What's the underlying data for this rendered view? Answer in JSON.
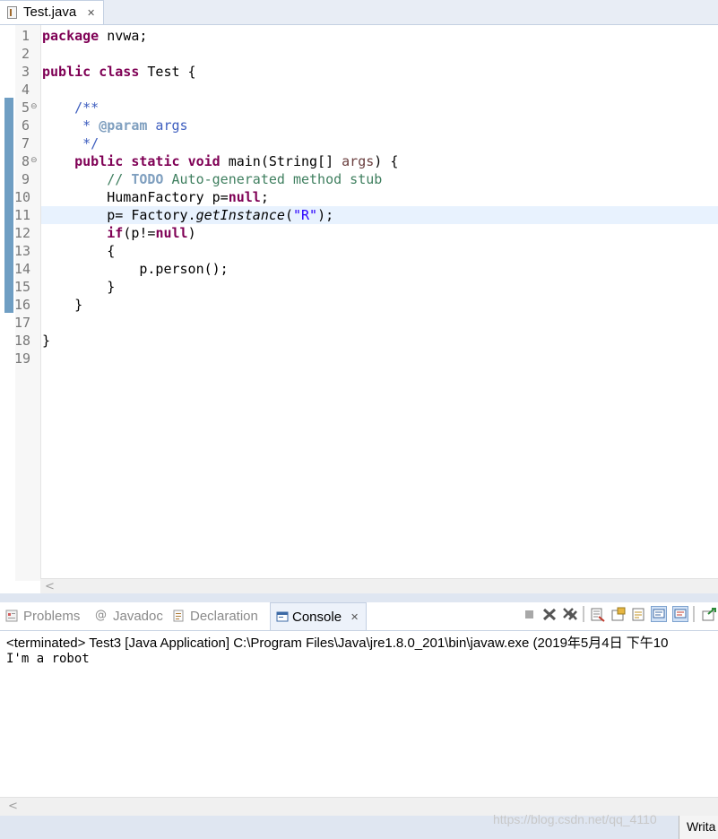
{
  "editor": {
    "tab": {
      "label": "Test.java",
      "close": "✕"
    },
    "lines": [
      {
        "n": "1",
        "fold": "",
        "parts": [
          {
            "t": "package",
            "c": "kw"
          },
          {
            "t": " nvwa;",
            "c": ""
          }
        ]
      },
      {
        "n": "2",
        "fold": "",
        "parts": []
      },
      {
        "n": "3",
        "fold": "",
        "parts": [
          {
            "t": "public",
            "c": "kw"
          },
          {
            "t": " ",
            "c": ""
          },
          {
            "t": "class",
            "c": "kw"
          },
          {
            "t": " Test {",
            "c": ""
          }
        ]
      },
      {
        "n": "4",
        "fold": "",
        "parts": []
      },
      {
        "n": "5",
        "fold": "⊖",
        "parts": [
          {
            "t": "    /**",
            "c": "jd"
          }
        ]
      },
      {
        "n": "6",
        "fold": "",
        "parts": [
          {
            "t": "     * ",
            "c": "jd"
          },
          {
            "t": "@param",
            "c": "jdt"
          },
          {
            "t": " args",
            "c": "jd"
          }
        ]
      },
      {
        "n": "7",
        "fold": "",
        "parts": [
          {
            "t": "     */",
            "c": "jd"
          }
        ]
      },
      {
        "n": "8",
        "fold": "⊖",
        "parts": [
          {
            "t": "    ",
            "c": ""
          },
          {
            "t": "public",
            "c": "kw"
          },
          {
            "t": " ",
            "c": ""
          },
          {
            "t": "static",
            "c": "kw"
          },
          {
            "t": " ",
            "c": ""
          },
          {
            "t": "void",
            "c": "kw"
          },
          {
            "t": " main(String[] ",
            "c": ""
          },
          {
            "t": "args",
            "c": "param"
          },
          {
            "t": ") {",
            "c": ""
          }
        ]
      },
      {
        "n": "9",
        "fold": "",
        "parts": [
          {
            "t": "        // ",
            "c": "cm"
          },
          {
            "t": "TODO",
            "c": "todo"
          },
          {
            "t": " Auto-generated method stub",
            "c": "cm"
          }
        ]
      },
      {
        "n": "10",
        "fold": "",
        "parts": [
          {
            "t": "        HumanFactory p=",
            "c": ""
          },
          {
            "t": "null",
            "c": "kw"
          },
          {
            "t": ";",
            "c": ""
          }
        ]
      },
      {
        "n": "11",
        "fold": "",
        "current": true,
        "parts": [
          {
            "t": "        p= Factory.",
            "c": ""
          },
          {
            "t": "getInstance",
            "c": "it"
          },
          {
            "t": "(",
            "c": ""
          },
          {
            "t": "\"R\"",
            "c": "str"
          },
          {
            "t": ");",
            "c": ""
          }
        ]
      },
      {
        "n": "12",
        "fold": "",
        "parts": [
          {
            "t": "        ",
            "c": ""
          },
          {
            "t": "if",
            "c": "kw"
          },
          {
            "t": "(p!=",
            "c": ""
          },
          {
            "t": "null",
            "c": "kw"
          },
          {
            "t": ")",
            "c": ""
          }
        ]
      },
      {
        "n": "13",
        "fold": "",
        "parts": [
          {
            "t": "        {",
            "c": ""
          }
        ]
      },
      {
        "n": "14",
        "fold": "",
        "parts": [
          {
            "t": "            p.person();",
            "c": ""
          }
        ]
      },
      {
        "n": "15",
        "fold": "",
        "parts": [
          {
            "t": "        }",
            "c": ""
          }
        ]
      },
      {
        "n": "16",
        "fold": "",
        "parts": [
          {
            "t": "    }",
            "c": ""
          }
        ]
      },
      {
        "n": "17",
        "fold": "",
        "parts": []
      },
      {
        "n": "18",
        "fold": "",
        "parts": [
          {
            "t": "}",
            "c": ""
          }
        ]
      },
      {
        "n": "19",
        "fold": "",
        "parts": []
      }
    ],
    "scroll_left": "<"
  },
  "panel": {
    "tabs": [
      {
        "label": "Problems",
        "icon": "problems-icon",
        "active": false
      },
      {
        "label": "Javadoc",
        "icon": "javadoc-at-icon",
        "glyph": "@",
        "active": false
      },
      {
        "label": "Declaration",
        "icon": "declaration-icon",
        "active": false
      },
      {
        "label": "Console",
        "icon": "console-icon",
        "active": true
      }
    ],
    "console_close": "✕",
    "status": "<terminated> Test3 [Java Application] C:\\Program Files\\Java\\jre1.8.0_201\\bin\\javaw.exe (2019年5月4日 下午10",
    "output": "I'm a robot",
    "scroll_left": "<"
  },
  "statusbar": {
    "field": "Writa"
  },
  "watermark": "https://blog.csdn.net/qq_4110",
  "colors": {
    "keyword": "#7f0055",
    "javadoc": "#3f5fbf",
    "comment": "#3f7f5f",
    "string": "#2a00ff",
    "current_line": "#e8f2fe"
  }
}
